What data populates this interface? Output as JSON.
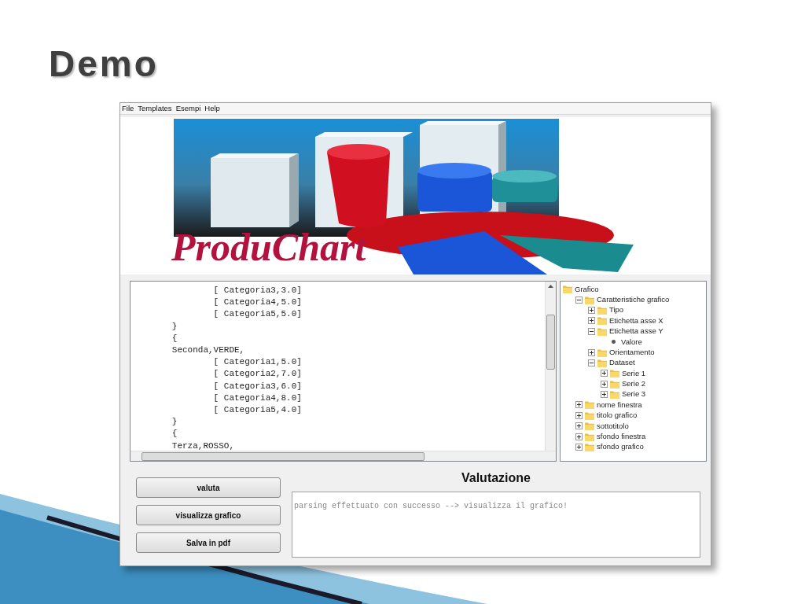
{
  "slide": {
    "title": "Demo"
  },
  "window": {
    "menu": [
      "File",
      "Templates",
      "Esempi",
      "Help"
    ],
    "logo": {
      "text": "ProduChart"
    },
    "editor": {
      "lines": [
        "                [ Categoria3,3.0]",
        "                [ Categoria4,5.0]",
        "                [ Categoria5,5.0]",
        "        }",
        "        {",
        "        Seconda,VERDE,",
        "                [ Categoria1,5.0]",
        "                [ Categoria2,7.0]",
        "                [ Categoria3,6.0]",
        "                [ Categoria4,8.0]",
        "                [ Categoria5,4.0]",
        "        }",
        "        {",
        "        Terza,ROSSO,"
      ]
    },
    "tree": [
      {
        "label": "Grafico",
        "kind": "root",
        "children": [
          {
            "label": "Caratteristiche grafico",
            "kind": "folder",
            "expanded": true,
            "children": [
              {
                "label": "Tipo",
                "kind": "folder",
                "expanded": false
              },
              {
                "label": "Etichetta asse X",
                "kind": "folder",
                "expanded": false
              },
              {
                "label": "Etichetta asse Y",
                "kind": "folder",
                "expanded": true,
                "children": [
                  {
                    "label": "Valore",
                    "kind": "leaf"
                  }
                ]
              },
              {
                "label": "Orientamento",
                "kind": "folder",
                "expanded": false
              },
              {
                "label": "Dataset",
                "kind": "folder",
                "expanded": true,
                "children": [
                  {
                    "label": "Serie 1",
                    "kind": "folder",
                    "expanded": false
                  },
                  {
                    "label": "Serie 2",
                    "kind": "folder",
                    "expanded": false
                  },
                  {
                    "label": "Serie 3",
                    "kind": "folder",
                    "expanded": false
                  }
                ]
              }
            ]
          },
          {
            "label": "nome finestra",
            "kind": "folder",
            "expanded": false
          },
          {
            "label": "titolo grafico",
            "kind": "folder",
            "expanded": false
          },
          {
            "label": "sottotitolo",
            "kind": "folder",
            "expanded": false
          },
          {
            "label": "sfondo finestra",
            "kind": "folder",
            "expanded": false
          },
          {
            "label": "sfondo grafico",
            "kind": "folder",
            "expanded": false
          }
        ]
      }
    ],
    "buttons": [
      "valuta",
      "visualizza grafico",
      "Salva in pdf"
    ],
    "evaluation": {
      "title": "Valutazione",
      "output": "parsing effettuato con successo --> visualizza il grafico!"
    }
  }
}
